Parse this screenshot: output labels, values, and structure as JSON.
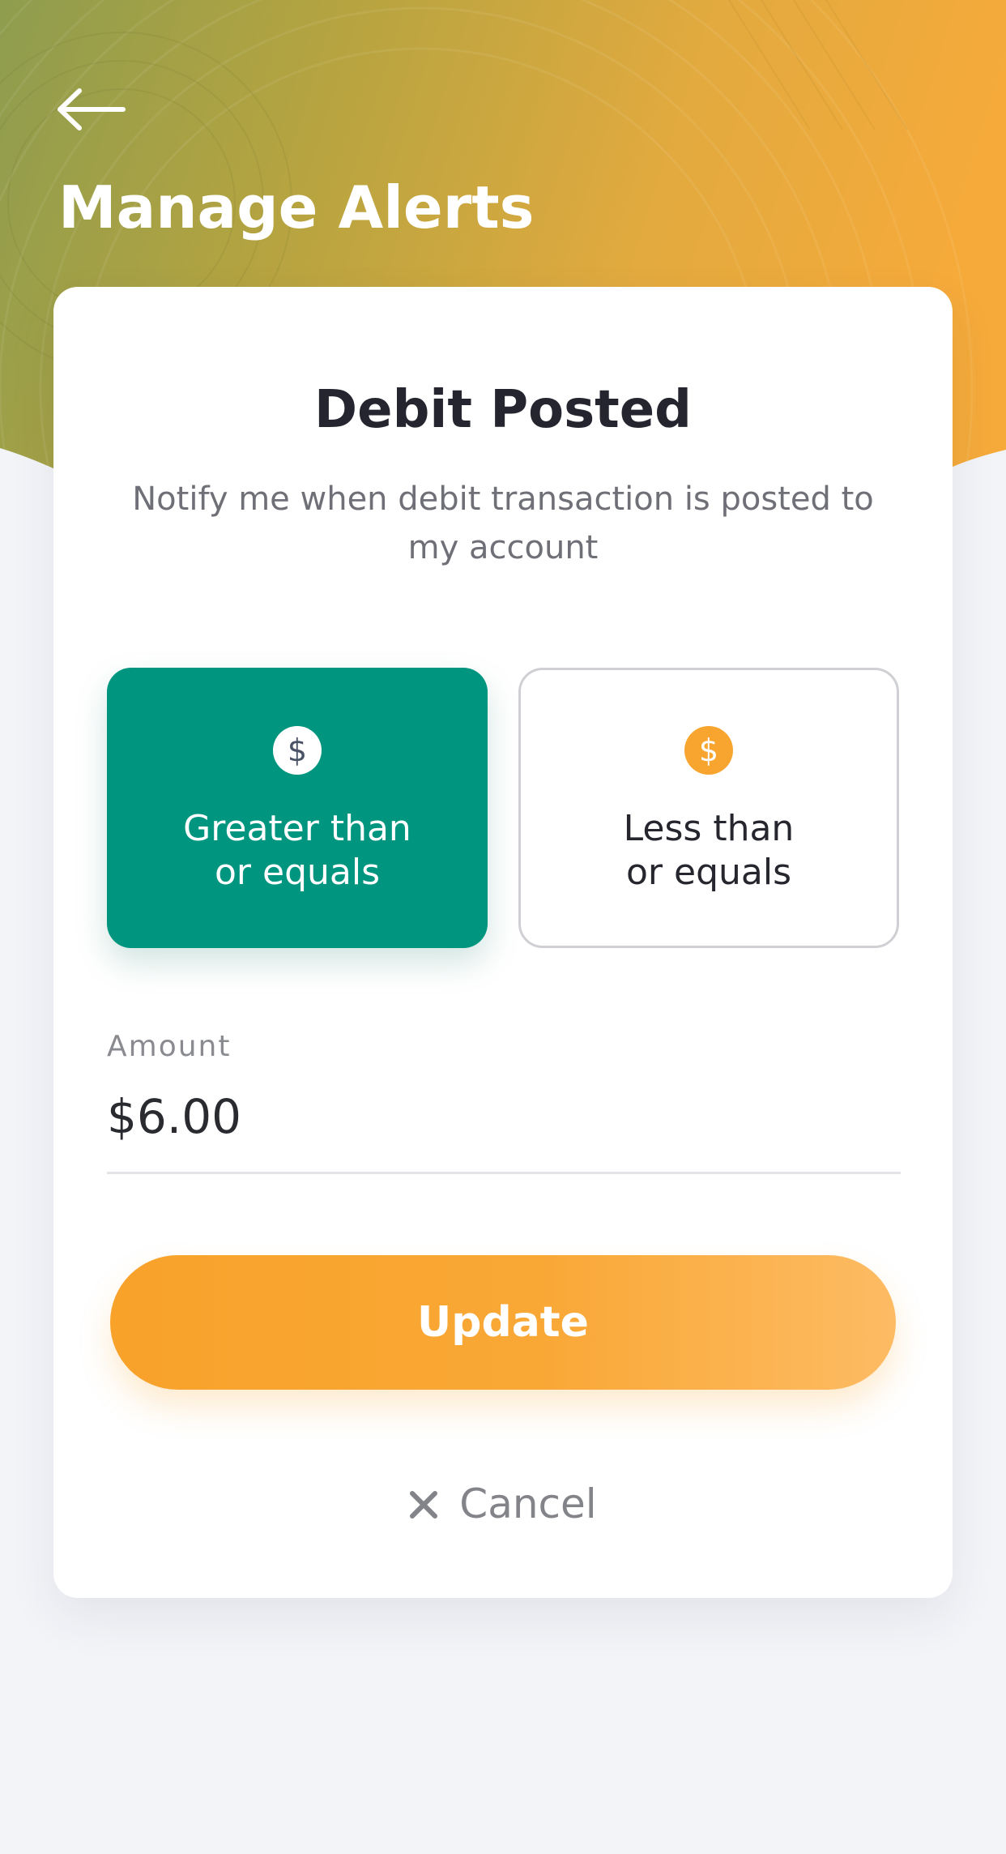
{
  "header": {
    "title": "Manage Alerts"
  },
  "card": {
    "title": "Debit Posted",
    "description": "Notify me when debit transaction is posted to my account"
  },
  "options": [
    {
      "icon": "dollar-icon",
      "glyph": "$",
      "label_line1": "Greater than",
      "label_line2": "or equals",
      "selected": true
    },
    {
      "icon": "dollar-icon",
      "glyph": "$",
      "label_line1": "Less than",
      "label_line2": "or equals",
      "selected": false
    }
  ],
  "amount": {
    "label": "Amount",
    "value": "$6.00"
  },
  "actions": {
    "update_label": "Update",
    "cancel_label": "Cancel"
  },
  "colors": {
    "selected_option": "#00957f",
    "accent": "#f8a530",
    "background": "#f3f4f8"
  }
}
